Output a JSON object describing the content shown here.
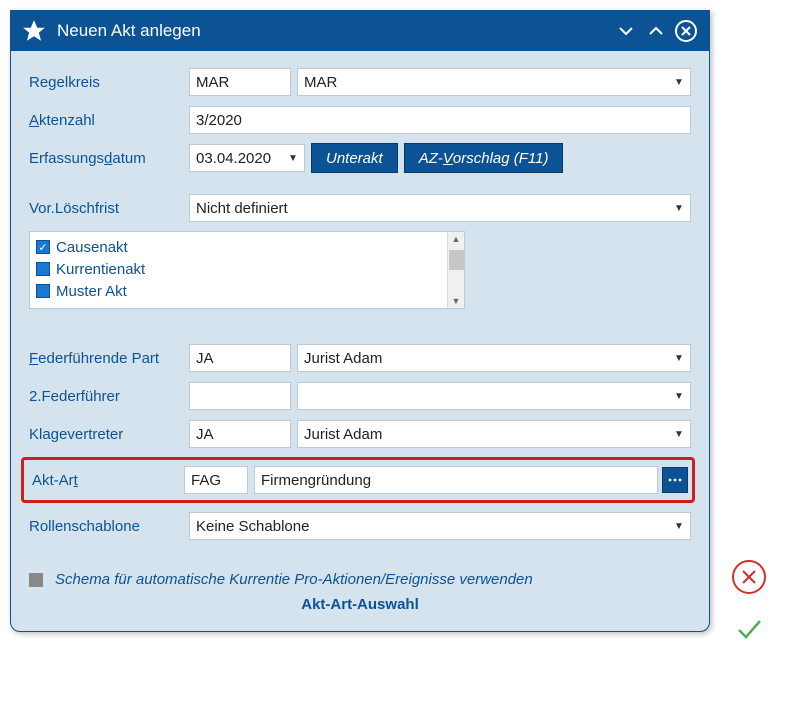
{
  "title": "Neuen Akt anlegen",
  "labels": {
    "regelkreis": "Regelkreis",
    "aktenzahl_pre": "A",
    "aktenzahl_post": "ktenzahl",
    "erfassung_pre": "Erfassungs",
    "erfassung_u": "d",
    "erfassung_post": "atum",
    "loeschfrist": "Vor.Löschfrist",
    "federf_pre": "F",
    "federf_post": "ederführende Part",
    "federf2": "2.Federführer",
    "klagevertreter": "Klagevertreter",
    "aktart_pre": "Akt-Ar",
    "aktart_u": "t",
    "rollenschablone": "Rollenschablone"
  },
  "regelkreis": {
    "code": "MAR",
    "name": "MAR"
  },
  "aktenzahl": "3/2020",
  "erfassungsdatum": "03.04.2020",
  "buttons": {
    "unterakt": "Unterakt",
    "azvorschlag_pre": "AZ-",
    "azvorschlag_u": "V",
    "azvorschlag_post": "orschlag (F11)"
  },
  "loeschfrist": "Nicht definiert",
  "aktTypes": [
    {
      "label": "Causenakt",
      "checked": true
    },
    {
      "label": "Kurrentienakt",
      "checked": false,
      "filled": true
    },
    {
      "label": "Muster Akt",
      "checked": false,
      "filled": true
    }
  ],
  "federfuehrend": {
    "code": "JA",
    "name": "Jurist Adam"
  },
  "federfuehrend2": {
    "code": "",
    "name": ""
  },
  "klagevertreter": {
    "code": "JA",
    "name": "Jurist Adam"
  },
  "aktart": {
    "code": "FAG",
    "name": "Firmengründung"
  },
  "rollenschablone": "Keine Schablone",
  "schemaText": "Schema für automatische Kurrentie Pro-Aktionen/Ereignisse verwenden",
  "footerLink": "Akt-Art-Auswahl"
}
